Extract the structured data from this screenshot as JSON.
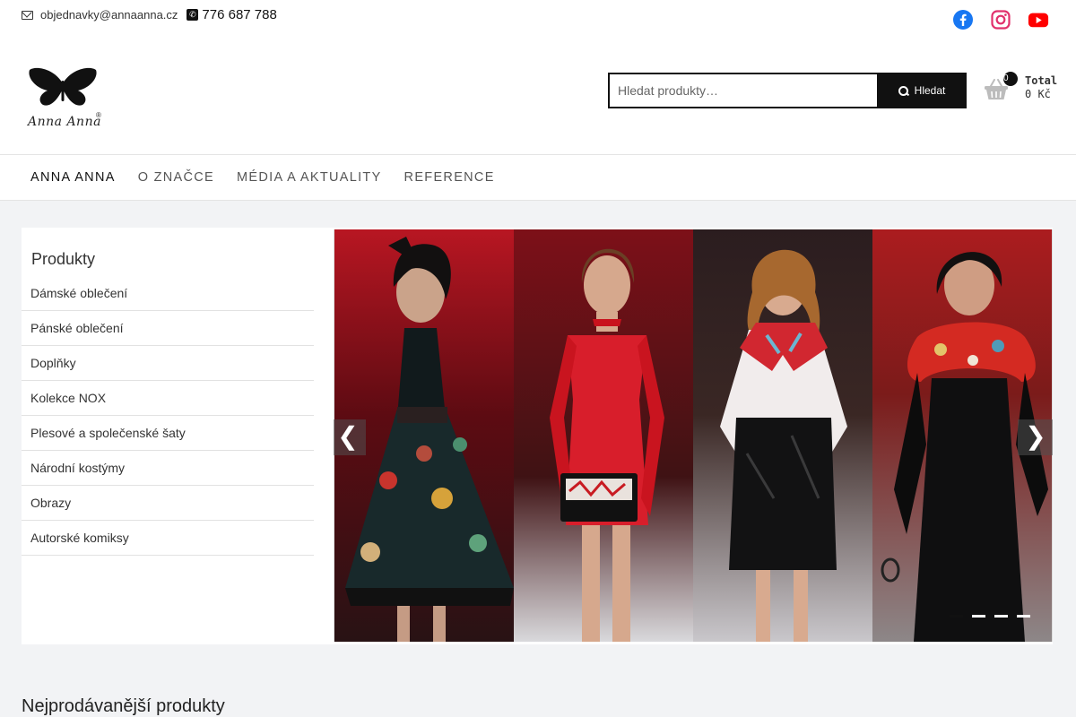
{
  "header": {
    "email": "objednavky@annaanna.cz",
    "phone": "776 687 788",
    "logo_text": "Anna Anna",
    "logo_mark": "®"
  },
  "social": [
    "facebook-icon",
    "instagram-icon",
    "youtube-icon"
  ],
  "search": {
    "placeholder": "Hledat produkty…",
    "button_label": "Hledat"
  },
  "cart": {
    "count": "0",
    "label": "Total",
    "price": "0 Kč"
  },
  "nav": {
    "items": [
      "ANNA ANNA",
      "O ZNAČCE",
      "MÉDIA A AKTUALITY",
      "REFERENCE"
    ]
  },
  "sidebar": {
    "title": "Produkty",
    "items": [
      "Dámské oblečení",
      "Pánské oblečení",
      "Doplňky",
      "Kolekce NOX",
      "Plesové a společenské šaty",
      "Národní kostýmy",
      "Obrazy",
      "Autorské komiksy"
    ]
  },
  "slider": {
    "prev": "❮",
    "next": "❯",
    "slide_count": 4,
    "active_slide": 1
  },
  "section": {
    "title": "Nejprodávanější produkty"
  },
  "colors": {
    "accent": "#111111",
    "background": "#f2f3f5",
    "facebook": "#1877f2",
    "instagram": "#e1306c",
    "youtube": "#ff0000"
  }
}
